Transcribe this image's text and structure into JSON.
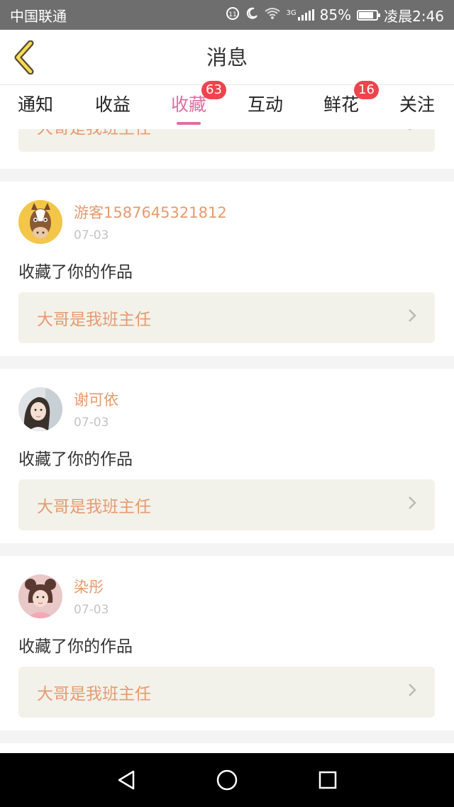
{
  "status_bar": {
    "carrier": "中国联通",
    "network": "3G",
    "battery": "85%",
    "battery_level": 0.85,
    "time": "凌晨2:46"
  },
  "header": {
    "title": "消息",
    "back_icon": "chevron-left-icon"
  },
  "tabs": [
    {
      "label": "通知",
      "active": false,
      "badge": ""
    },
    {
      "label": "收益",
      "active": false,
      "badge": ""
    },
    {
      "label": "收藏",
      "active": true,
      "badge": "63"
    },
    {
      "label": "互动",
      "active": false,
      "badge": ""
    },
    {
      "label": "鲜花",
      "active": false,
      "badge": "16"
    },
    {
      "label": "关注",
      "active": false,
      "badge": ""
    }
  ],
  "partial_top_item": {
    "work_title": "大哥是我班主任"
  },
  "items": [
    {
      "username": "游客1587645321812",
      "date": "07-03",
      "action": "收藏了你的作品",
      "work_title": "大哥是我班主任",
      "avatar": "horse-avatar"
    },
    {
      "username": "谢可依",
      "date": "07-03",
      "action": "收藏了你的作品",
      "work_title": "大哥是我班主任",
      "avatar": "girl-photo-avatar"
    },
    {
      "username": "染彤",
      "date": "07-03",
      "action": "收藏了你的作品",
      "work_title": "大哥是我班主任",
      "avatar": "girl-pink-avatar"
    }
  ],
  "colors": {
    "accent_pink": "#e06da0",
    "username_orange": "#e59a6f",
    "badge_red": "#f0434b",
    "link_bg": "#f3f2ea"
  }
}
